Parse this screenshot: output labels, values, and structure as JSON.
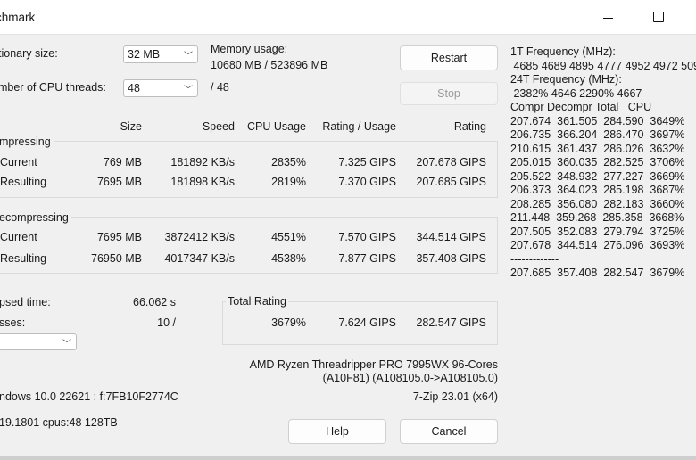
{
  "window": {
    "title": "chmark"
  },
  "settings": {
    "dict_label": "tionary size:",
    "dict_value": "32 MB",
    "threads_label": "mber of CPU threads:",
    "threads_value": "48",
    "threads_total": "/ 48",
    "memory_label": "Memory usage:",
    "memory_value": "10680 MB / 523896 MB"
  },
  "buttons": {
    "restart": "Restart",
    "stop": "Stop",
    "help": "Help",
    "cancel": "Cancel"
  },
  "table": {
    "headers": [
      "Size",
      "Speed",
      "CPU Usage",
      "Rating / Usage",
      "Rating"
    ],
    "compressing": {
      "label": "mpressing",
      "rows": [
        {
          "name": "Current",
          "size": "769 MB",
          "speed": "181892 KB/s",
          "cpu": "2835%",
          "rpu": "7.325 GIPS",
          "rating": "207.678 GIPS"
        },
        {
          "name": "Resulting",
          "size": "7695 MB",
          "speed": "181898 KB/s",
          "cpu": "2819%",
          "rpu": "7.370 GIPS",
          "rating": "207.685 GIPS"
        }
      ]
    },
    "decompressing": {
      "label": "ecompressing",
      "rows": [
        {
          "name": "Current",
          "size": "7695 MB",
          "speed": "3872412 KB/s",
          "cpu": "4551%",
          "rpu": "7.570 GIPS",
          "rating": "344.514 GIPS"
        },
        {
          "name": "Resulting",
          "size": "76950 MB",
          "speed": "4017347 KB/s",
          "cpu": "4538%",
          "rpu": "7.877 GIPS",
          "rating": "357.408 GIPS"
        }
      ]
    }
  },
  "stats": {
    "elapsed_label": "psed time:",
    "elapsed_value": "66.062 s",
    "passes_label": "sses:",
    "passes_value": "10 /",
    "total_label": "Total Rating",
    "total_cpu": "3679%",
    "total_rpu": "7.624 GIPS",
    "total_rating": "282.547 GIPS"
  },
  "system": {
    "cpu_line1": "AMD Ryzen Threadripper PRO 7995WX 96-Cores",
    "cpu_line2": "(A10F81) (A108105.0->A108105.0)",
    "os": "ndows 10.0 22621 :  f:7FB10F2774C",
    "version": "7-Zip 23.01 (x64)",
    "build": "19.1801 cpus:48 128TB"
  },
  "frequency_log": {
    "lines": [
      "1T Frequency (MHz):",
      " 4685 4689 4895 4777 4952 4972 509",
      "24T Frequency (MHz):",
      " 2382% 4646 2290% 4667",
      "Compr Decompr Total   CPU",
      "207.674  361.505  284.590  3649%",
      "206.735  366.204  286.470  3697%",
      "210.615  361.437  286.026  3632%",
      "205.015  360.035  282.525  3706%",
      "205.522  348.932  277.227  3669%",
      "206.373  364.023  285.198  3687%",
      "208.285  356.080  282.183  3660%",
      "211.448  359.268  285.358  3668%",
      "207.505  352.083  279.794  3725%",
      "207.678  344.514  276.096  3693%",
      "-------------",
      "207.685  357.408  282.547  3679%"
    ]
  }
}
